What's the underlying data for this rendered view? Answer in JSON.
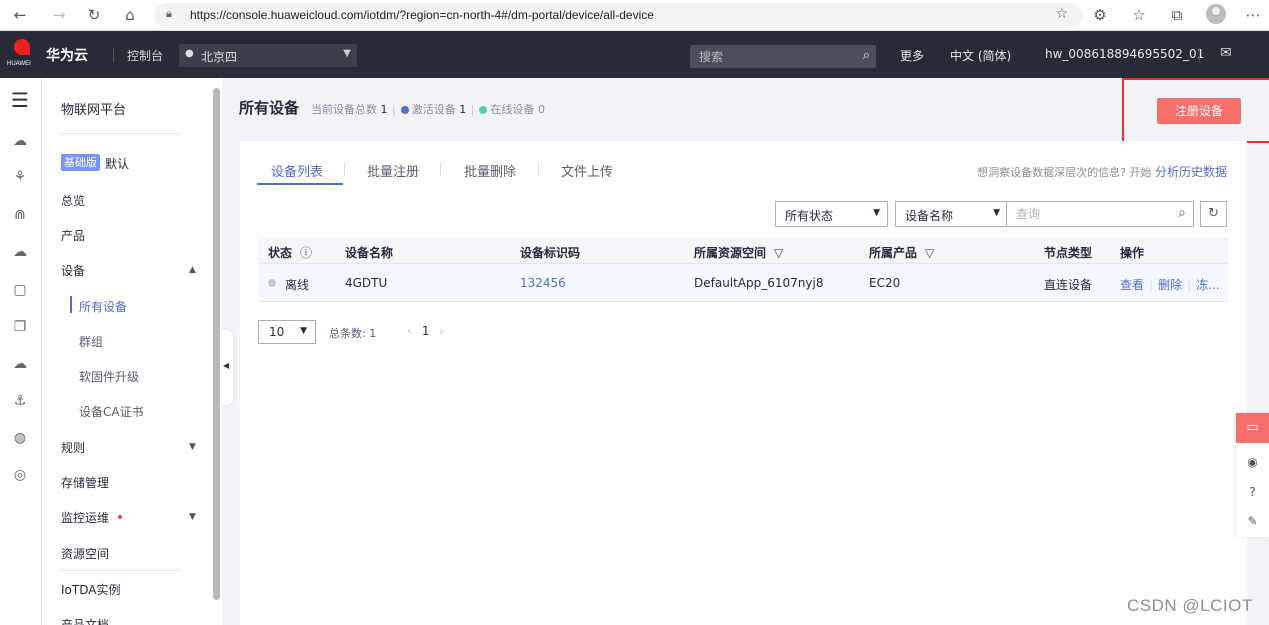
{
  "browser": {
    "url": "https://console.huaweicloud.com/iotdm/?region=cn-north-4#/dm-portal/device/all-device",
    "icons": [
      "back-arrow-icon",
      "forward-arrow-icon",
      "reload-icon",
      "home-icon",
      "lock-icon",
      "favorite-star-icon",
      "extensions-icon",
      "favorites-icon",
      "collections-icon",
      "profile-icon",
      "more-icon"
    ]
  },
  "topnav": {
    "logo_text": "HUAWEI",
    "brand": "华为云",
    "console": "控制台",
    "region": "北京四",
    "search_placeholder": "搜索",
    "more": "更多",
    "language": "中文 (简体)",
    "account": "hw_008618894695502_01"
  },
  "sidebar": {
    "title": "物联网平台",
    "edition_tag": "基础版",
    "edition_default": "默认",
    "items": [
      {
        "label": "总览"
      },
      {
        "label": "产品"
      },
      {
        "label": "设备"
      },
      {
        "label": "规则"
      },
      {
        "label": "存储管理"
      },
      {
        "label": "监控运维"
      },
      {
        "label": "资源空间"
      },
      {
        "label": "IoTDA实例"
      },
      {
        "label": "产品文档"
      }
    ],
    "device_subitems": [
      {
        "label": "所有设备"
      },
      {
        "label": "群组"
      },
      {
        "label": "软固件升级"
      },
      {
        "label": "设备CA证书"
      }
    ]
  },
  "main": {
    "page_title": "所有设备",
    "stats": {
      "total_label": "当前设备总数",
      "total_value": "1",
      "active_label": "激活设备",
      "active_value": "1",
      "online_label": "在线设备",
      "online_value": "0"
    },
    "register_button": "注册设备",
    "tabs": [
      {
        "label": "设备列表"
      },
      {
        "label": "批量注册"
      },
      {
        "label": "批量删除"
      },
      {
        "label": "文件上传"
      }
    ],
    "hint_text": "想洞察设备数据深层次的信息? 开始",
    "hint_link": "分析历史数据",
    "filter_status": "所有状态",
    "filter_field": "设备名称",
    "query_placeholder": "查询",
    "columns": [
      "状态",
      "设备名称",
      "设备标识码",
      "所属资源空间",
      "所属产品",
      "节点类型",
      "操作"
    ],
    "rows": [
      {
        "status": "离线",
        "name": "4GDTU",
        "identifier": "132456",
        "space": "DefaultApp_6107nyj8",
        "product": "EC20",
        "node_type": "直连设备",
        "ops": [
          "查看",
          "删除",
          "冻..."
        ]
      }
    ],
    "page_size": "10",
    "total_label": "总条数: 1",
    "current_page": "1"
  },
  "colors": {
    "accent": "#526ecc",
    "register": "#f66f6a",
    "highlight_border": "#e8332c",
    "active_dot": "#526ecc",
    "online_dot": "#50d4ab"
  },
  "watermark": "CSDN @LCIOT"
}
